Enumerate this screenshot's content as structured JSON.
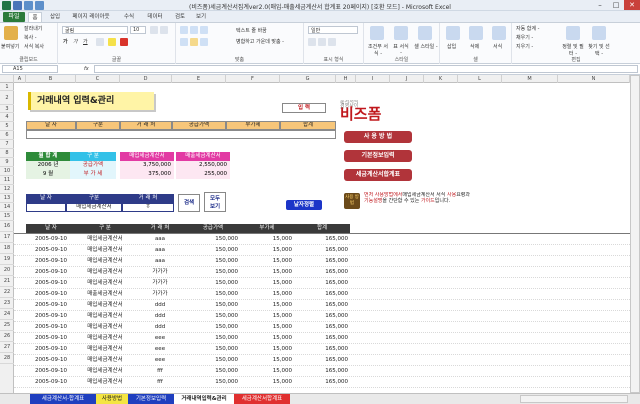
{
  "window": {
    "title": "(비즈폼)세금계산서집계ver2.0(매입-매출세금계산서 합계표 20페이지) [호환 모드] - Microsoft Excel",
    "minimize": "–",
    "maximize": "□",
    "close": "✕"
  },
  "ribbon_tabs": [
    "파일",
    "홈",
    "삽입",
    "페이지 레이아웃",
    "수식",
    "데이터",
    "검토",
    "보기"
  ],
  "ribbon": {
    "clipboard": {
      "paste": "붙여넣기",
      "cut": "잘라내기",
      "copy": "복사 -",
      "format_painter": "서식 복사",
      "label": "클립보드"
    },
    "font": {
      "name": "굴림",
      "size": "10",
      "bold": "가",
      "italic": "가",
      "underline": "가",
      "label": "글꼴"
    },
    "alignment": {
      "wrap": "텍스트 줄 바꿈",
      "merge": "병합하고 가운데 맞춤 -",
      "label": "맞춤"
    },
    "number": {
      "format": "일반",
      "label": "표시 형식"
    },
    "styles": {
      "cond": "조건부 서식 -",
      "table": "표 서식 -",
      "cell": "셀 스타일 -",
      "label": "스타일"
    },
    "cells": {
      "insert": "삽입",
      "delete": "삭제",
      "format": "서식",
      "label": "셀"
    },
    "editing": {
      "autosum": "자동 합계 -",
      "fill": "채우기 -",
      "clear": "지우기 -",
      "sort": "정렬 및 필터 -",
      "find": "찾기 및 선택 -",
      "label": "편집"
    }
  },
  "formula_bar": {
    "name_box": "A15",
    "fx": "fx",
    "value": ""
  },
  "columns": [
    "A",
    "B",
    "C",
    "D",
    "E",
    "F",
    "G",
    "H",
    "I",
    "J",
    "K",
    "L",
    "M",
    "N"
  ],
  "rows": [
    "1",
    "2",
    "3",
    "4",
    "5",
    "6",
    "7",
    "8",
    "9",
    "10",
    "11",
    "12",
    "13",
    "14",
    "15",
    "16",
    "17",
    "18",
    "19",
    "20",
    "21",
    "22",
    "23",
    "24",
    "25",
    "26",
    "27",
    "28"
  ],
  "sheet": {
    "heading": "거래내역 입력&관리",
    "input_button": "입  력",
    "logo": "비즈폼",
    "logo_sub": "문서서식 경영사이트",
    "entry_headers": [
      "날  자",
      "구분",
      "거 래 처",
      "공급가액",
      "부가세",
      "합계"
    ],
    "summary_headers": [
      "월 합 계",
      "구  분",
      "매입세금계산서",
      "매출세금계산서"
    ],
    "summary_rows": [
      {
        "a": "2006 년",
        "b": "공급가액",
        "c": "3,750,000",
        "d": "2,550,000"
      },
      {
        "a": "9 월",
        "b": "부 가 세",
        "c": "375,000",
        "d": "255,000"
      }
    ],
    "search_headers": [
      "날  자",
      "구분",
      "거 래 처"
    ],
    "search_values": {
      "date": "",
      "type": "매입세금계산서",
      "client": "ㅎ"
    },
    "search_button": "검색",
    "showall_button_1": "모두",
    "showall_button_2": "보기",
    "date_sort_button": "날자정렬",
    "nav_buttons": [
      "사 용 방 법",
      "기본정보입력",
      "세금계산서합계표"
    ],
    "note_badge": "사용\n방법",
    "note_text_1": "먼저 사용방법에서",
    "note_text_2": "매입세금계산서 서식",
    "note_text_3": "사용",
    "note_text_4": "요령과",
    "note_text_5": "기능설명",
    "note_text_6": "을 간단합 수 있는",
    "note_text_7": "가이드",
    "note_text_8": "입니다.",
    "data_headers": [
      "날  자",
      "구 분",
      "거 래 처",
      "공급가액",
      "부가세",
      "합계"
    ],
    "data_rows": [
      [
        "2005-09-10",
        "매입세금계산서",
        "aaa",
        "150,000",
        "15,000",
        "165,000"
      ],
      [
        "2005-09-10",
        "매입세금계산서",
        "aaa",
        "150,000",
        "15,000",
        "165,000"
      ],
      [
        "2005-09-10",
        "매입세금계산서",
        "aaa",
        "150,000",
        "15,000",
        "165,000"
      ],
      [
        "2005-09-10",
        "매입세금계산서",
        "가가가",
        "150,000",
        "15,000",
        "165,000"
      ],
      [
        "2005-09-10",
        "매입세금계산서",
        "가가가",
        "150,000",
        "15,000",
        "165,000"
      ],
      [
        "2005-09-10",
        "매출세금계산서",
        "가가가",
        "150,000",
        "15,000",
        "165,000"
      ],
      [
        "2005-09-10",
        "매입세금계산서",
        "ddd",
        "150,000",
        "15,000",
        "165,000"
      ],
      [
        "2005-09-10",
        "매입세금계산서",
        "ddd",
        "150,000",
        "15,000",
        "165,000"
      ],
      [
        "2005-09-10",
        "매입세금계산서",
        "ddd",
        "150,000",
        "15,000",
        "165,000"
      ],
      [
        "2005-09-10",
        "매입세금계산서",
        "eee",
        "150,000",
        "15,000",
        "165,000"
      ],
      [
        "2005-09-10",
        "매입세금계산서",
        "eee",
        "150,000",
        "15,000",
        "165,000"
      ],
      [
        "2005-09-10",
        "매입세금계산서",
        "eee",
        "150,000",
        "15,000",
        "165,000"
      ],
      [
        "2005-09-10",
        "매입세금계산서",
        "fff",
        "150,000",
        "15,000",
        "165,000"
      ],
      [
        "2005-09-10",
        "매입세금계산서",
        "fff",
        "150,000",
        "15,000",
        "165,000"
      ]
    ]
  },
  "sheet_tabs": [
    "세금계산서-합계표",
    "사용방법",
    "기본정보입력",
    "거래내역입력&관리",
    "세금계산서합계표"
  ],
  "status": {
    "zoom": "70%"
  },
  "colors": {
    "orange": "#f7c67a",
    "green": "#2e8b3a",
    "cyan": "#33c1e8",
    "pink": "#e23aa3",
    "nav_red": "#b1343a",
    "title_yellow": "#fff4a6"
  }
}
